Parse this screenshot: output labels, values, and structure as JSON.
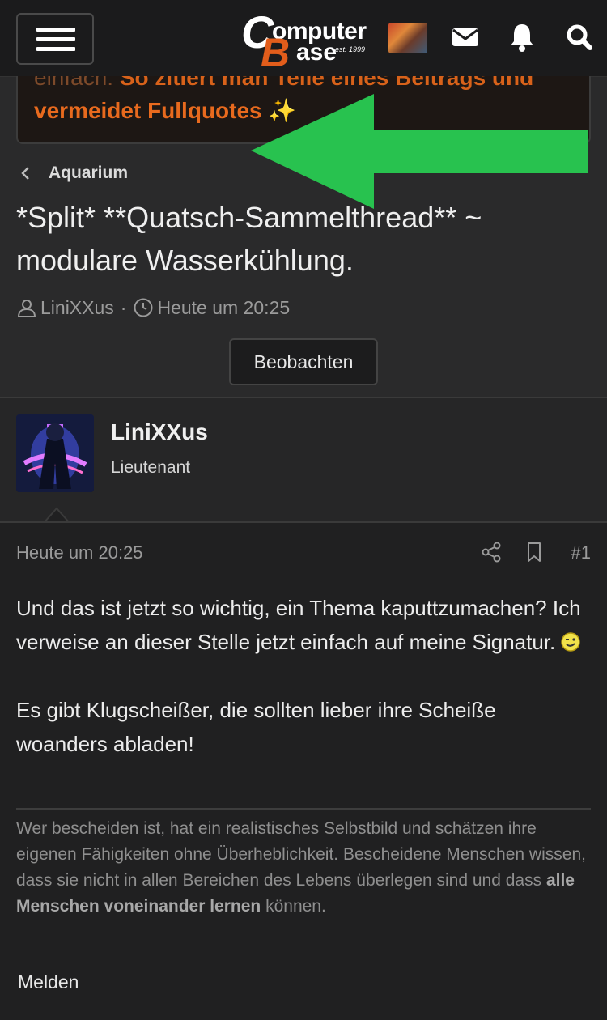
{
  "header": {
    "logo_line1": "omputer",
    "logo_line2": "ase",
    "logo_c": "C",
    "logo_b": "B",
    "logo_est": "est. 1999",
    "icons": [
      "menu-icon",
      "mail-icon",
      "bell-icon",
      "search-icon"
    ]
  },
  "banner": {
    "line1_prefix": "einfach. ",
    "line1": "So zitiert man Teile eines Beitrags und",
    "line2": "vermeidet Fullquotes",
    "line2_emoji": "✨",
    "accent_color": "#e86a1e"
  },
  "overlay": {
    "arrow_color": "#28c24f"
  },
  "breadcrumb": {
    "label": "Aquarium"
  },
  "thread": {
    "title": "*Split* **Quatsch-Sammelthread** ~ modulare Wasserkühlung.",
    "author": "LiniXXus",
    "separator": "·",
    "time": "Heute um 20:25",
    "watch_button": "Beobachten"
  },
  "user": {
    "name": "LiniXXus",
    "title": "Lieutenant"
  },
  "post": {
    "date": "Heute um 20:25",
    "number": "#1",
    "paragraph1": "Und das ist jetzt so wichtig, ein Thema kaputtzumachen? Ich verweise an dieser Stelle jetzt einfach auf meine Signatur.",
    "paragraph2": "Es gibt Klugscheißer, die sollten lieber ihre Scheiße woanders abladen!",
    "signature_text": "Wer bescheiden ist, hat ein realistisches Selbstbild und schätzen ihre eigenen Fähigkeiten ohne Überheblichkeit. Bescheidene Menschen wissen, dass sie nicht in allen Bereichen des Lebens überlegen sind und dass ",
    "signature_bold": "alle Menschen voneinander lernen",
    "signature_end": " können.",
    "report_label": "Melden"
  }
}
